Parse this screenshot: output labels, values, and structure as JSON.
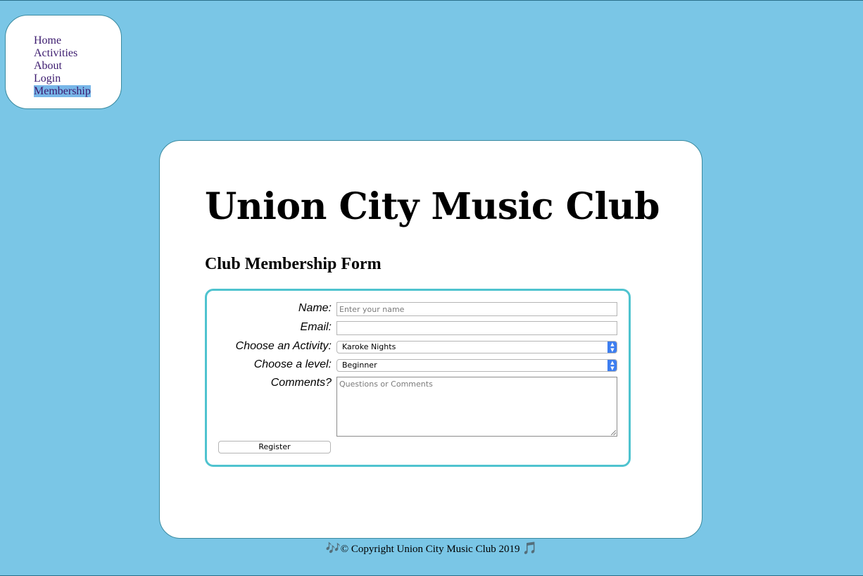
{
  "nav": {
    "items": [
      {
        "label": "Home"
      },
      {
        "label": "Activities"
      },
      {
        "label": "About"
      },
      {
        "label": "Login"
      },
      {
        "label": "Membership",
        "active": true
      }
    ]
  },
  "main": {
    "title": "Union City Music Club",
    "subtitle": "Club Membership Form"
  },
  "form": {
    "name_label": "Name:",
    "name_placeholder": "Enter your name",
    "email_label": "Email:",
    "email_value": "",
    "activity_label": "Choose an Activity:",
    "activity_selected": "Karoke Nights",
    "level_label": "Choose a level:",
    "level_selected": "Beginner",
    "comments_label": "Comments?",
    "comments_placeholder": "Questions or Comments",
    "register_label": "Register"
  },
  "footer": {
    "icon_left": "🎶",
    "text": "© Copyright Union City Music Club 2019",
    "icon_right": "🎵"
  },
  "colors": {
    "background": "#7ac6e6",
    "form_border": "#4fc3cf",
    "nav_link": "#3b1a6e",
    "active_highlight": "#78b6e8",
    "select_arrow": "#3d7ef0"
  }
}
